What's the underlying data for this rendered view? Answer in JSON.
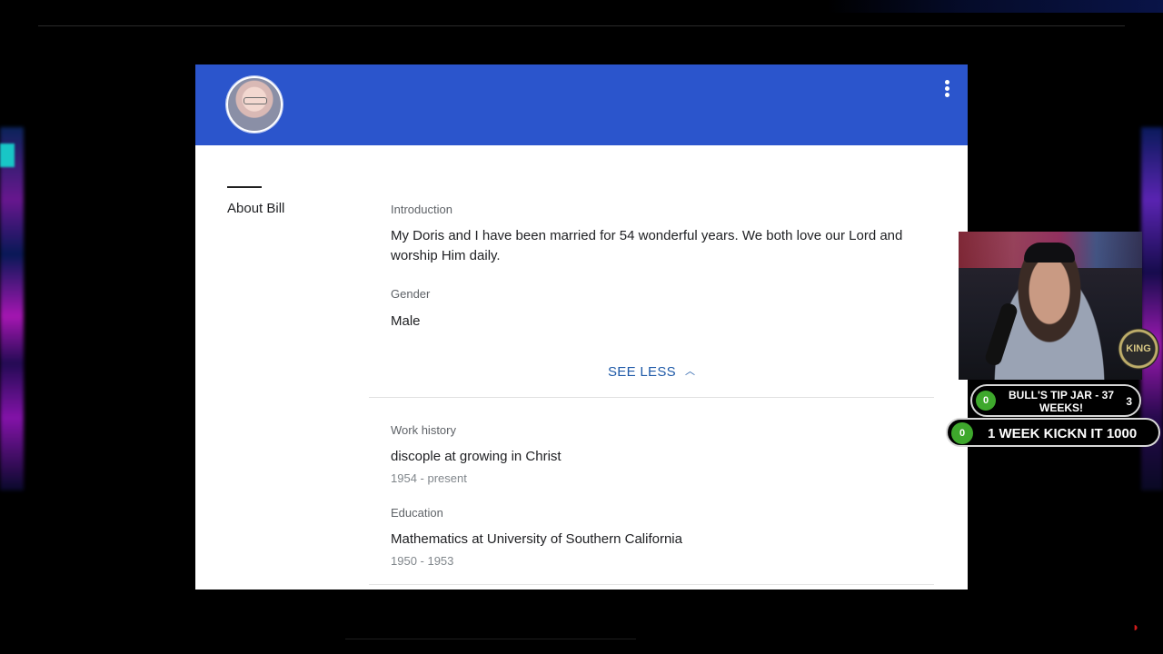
{
  "profile": {
    "about_title": "About Bill",
    "introduction_label": "Introduction",
    "introduction_text": "My Doris and I have been married for 54 wonderful years. We both love our Lord and worship Him daily.",
    "gender_label": "Gender",
    "gender_value": "Male",
    "see_less_label": "SEE LESS",
    "work_history_label": "Work history",
    "work_title": "discople at growing in Christ",
    "work_dates": "1954 - present",
    "education_label": "Education",
    "education_title": "Mathematics at University of Southern California",
    "education_dates": "1950 - 1953"
  },
  "header": {
    "menu_icon": "more-vert-icon",
    "color": "#2b55cc"
  },
  "overlay": {
    "tip_jar": {
      "left_count": "0",
      "label": "BULL'S TIP JAR - 37 WEEKS!",
      "right_count": "3"
    },
    "goal": {
      "count": "0",
      "label": "1 WEEK KICKN IT 1000"
    },
    "badge_text": "KING"
  }
}
